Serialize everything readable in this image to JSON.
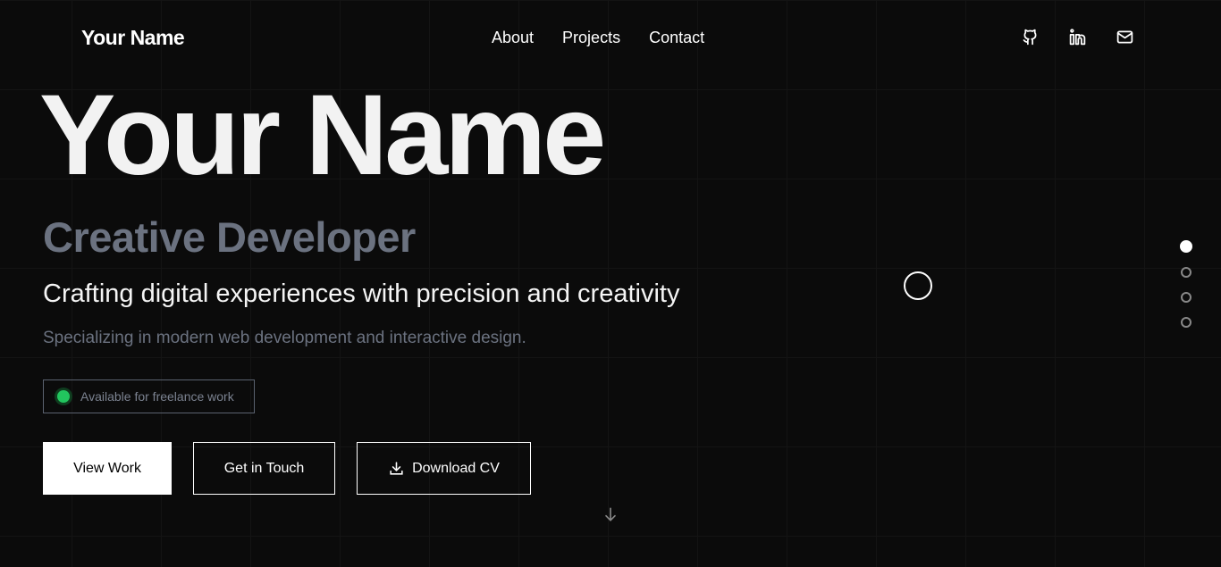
{
  "header": {
    "logo": "Your Name",
    "nav": [
      "About",
      "Projects",
      "Contact"
    ],
    "social": [
      "github-icon",
      "linkedin-icon",
      "mail-icon"
    ]
  },
  "hero": {
    "name": "Your Name",
    "role": "Creative Developer",
    "tagline": "Crafting digital experiences with precision and creativity",
    "description": "Specializing in modern web development and interactive design.",
    "availability": "Available for freelance work",
    "buttons": {
      "view_work": "View Work",
      "get_in_touch": "Get in Touch",
      "download_cv": "Download CV"
    }
  },
  "section_nav": {
    "count": 4,
    "active": 1
  },
  "colors": {
    "background": "#0b0b0b",
    "muted": "#6b7280",
    "status": "#22c55e"
  }
}
